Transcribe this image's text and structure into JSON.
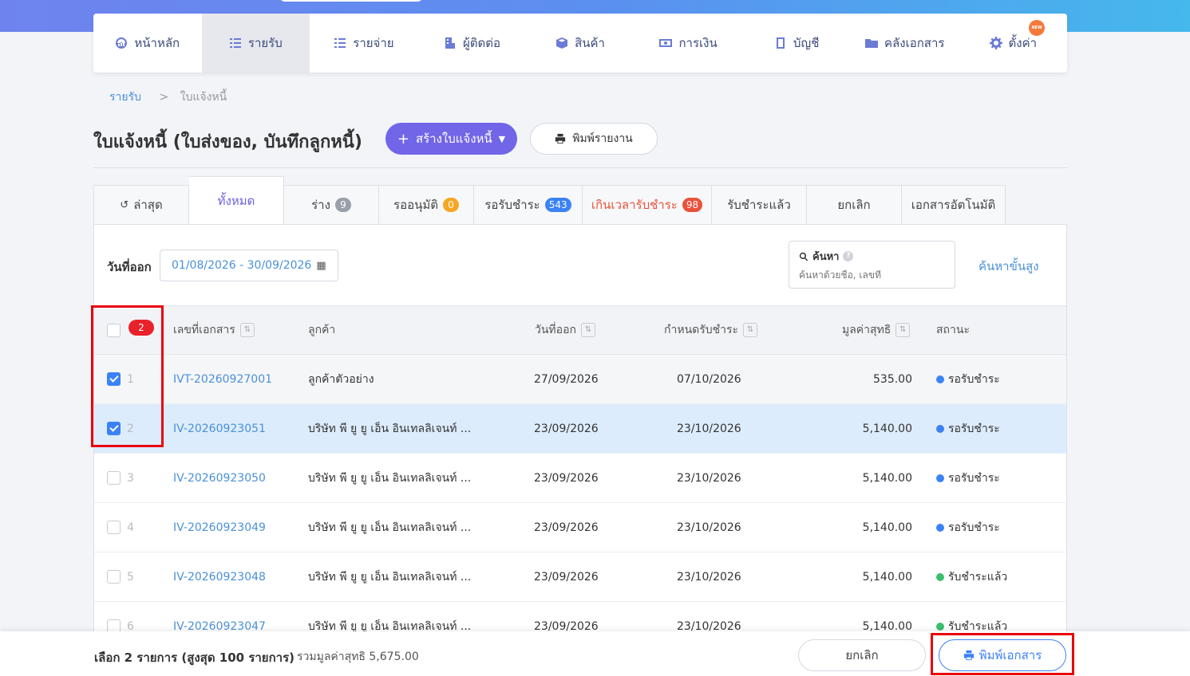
{
  "nav": {
    "items": [
      {
        "label": "หน้าหลัก",
        "icon": "dashboard-icon",
        "active": false
      },
      {
        "label": "รายรับ",
        "icon": "income-list-icon",
        "active": true
      },
      {
        "label": "รายจ่าย",
        "icon": "expense-list-icon",
        "active": false
      },
      {
        "label": "ผู้ติดต่อ",
        "icon": "contacts-icon",
        "active": false
      },
      {
        "label": "สินค้า",
        "icon": "product-box-icon",
        "active": false
      },
      {
        "label": "การเงิน",
        "icon": "money-icon",
        "active": false
      },
      {
        "label": "บัญชี",
        "icon": "ledger-book-icon",
        "active": false
      },
      {
        "label": "คลังเอกสาร",
        "icon": "folder-icon",
        "active": false
      },
      {
        "label": "ตั้งค่า",
        "icon": "gear-icon",
        "active": false
      }
    ],
    "new_badge": "NEW"
  },
  "breadcrumb": {
    "parent": "รายรับ",
    "separator": ">",
    "current": "ใบแจ้งหนี้"
  },
  "page": {
    "title": "ใบแจ้งหนี้ (ใบส่งของ, บันทึกลูกหนี้)",
    "create_button": "สร้างใบแจ้งหนี้",
    "report_button": "พิมพ์รายงาน"
  },
  "tabs": [
    {
      "label": "ล่าสุด",
      "count": null
    },
    {
      "label": "ทั้งหมด",
      "count": null
    },
    {
      "label": "ร่าง",
      "count": "9"
    },
    {
      "label": "รออนุมัติ",
      "count": "0"
    },
    {
      "label": "รอรับชำระ",
      "count": "543"
    },
    {
      "label": "เกินเวลารับชำระ",
      "count": "98"
    },
    {
      "label": "รับชำระแล้ว",
      "count": null
    },
    {
      "label": "ยกเลิก",
      "count": null
    },
    {
      "label": "เอกสารอัตโนมัติ",
      "count": null
    }
  ],
  "filters": {
    "date_label": "วันที่ออก",
    "date_range": "01/08/2026 - 30/09/2026",
    "search_label": "ค้นหา",
    "search_placeholder": "ค้นหาด้วยชื่อ, เลขที่",
    "advanced_search": "ค้นหาขั้นสูง"
  },
  "table": {
    "selected_count": "2",
    "headers": {
      "doc_no": "เลขที่เอกสาร",
      "customer": "ลูกค้า",
      "issue_date": "วันที่ออก",
      "due_date": "กำหนดรับชำระ",
      "net_value": "มูลค่าสุทธิ",
      "status": "สถานะ"
    },
    "rows": [
      {
        "num": "1",
        "doc_no": "IVT-20260927001",
        "customer": "ลูกค้าตัวอย่าง",
        "issue_date": "27/09/2026",
        "due_date": "07/10/2026",
        "net_value": "535.00",
        "status": "รอรับชำระ",
        "checked": true
      },
      {
        "num": "2",
        "doc_no": "IV-20260923051",
        "customer": "บริษัท พี ยู ยู เอ็น อินเทลลิเจนท์ ...",
        "issue_date": "23/09/2026",
        "due_date": "23/10/2026",
        "net_value": "5,140.00",
        "status": "รอรับชำระ",
        "checked": true
      },
      {
        "num": "3",
        "doc_no": "IV-20260923050",
        "customer": "บริษัท พี ยู ยู เอ็น อินเทลลิเจนท์ ...",
        "issue_date": "23/09/2026",
        "due_date": "23/10/2026",
        "net_value": "5,140.00",
        "status": "รอรับชำระ",
        "checked": false
      },
      {
        "num": "4",
        "doc_no": "IV-20260923049",
        "customer": "บริษัท พี ยู ยู เอ็น อินเทลลิเจนท์ ...",
        "issue_date": "23/09/2026",
        "due_date": "23/10/2026",
        "net_value": "5,140.00",
        "status": "รอรับชำระ",
        "checked": false
      },
      {
        "num": "5",
        "doc_no": "IV-20260923048",
        "customer": "บริษัท พี ยู ยู เอ็น อินเทลลิเจนท์ ...",
        "issue_date": "23/09/2026",
        "due_date": "23/10/2026",
        "net_value": "5,140.00",
        "status": "รับชำระแล้ว",
        "checked": false
      },
      {
        "num": "6",
        "doc_no": "IV-20260923047",
        "customer": "บริษัท พี ยู ยู เอ็น อินเทลลิเจนท์ ...",
        "issue_date": "23/09/2026",
        "due_date": "23/10/2026",
        "net_value": "5,140.00",
        "status": "รับชำระแล้ว",
        "checked": false
      }
    ]
  },
  "bottom_bar": {
    "selection_text": "เลือก 2 รายการ (สูงสุด 100 รายการ)",
    "sum_text": "รวมมูลค่าสุทธิ 5,675.00",
    "cancel_button": "ยกเลิก",
    "print_button": "พิมพ์เอกสาร"
  },
  "colors": {
    "accent": "#7165e8",
    "link": "#4a90d9",
    "status_pending": "#3b82f6",
    "status_paid": "#3dbf6e",
    "overdue": "#e8523b",
    "highlight_box": "#e8000b"
  }
}
